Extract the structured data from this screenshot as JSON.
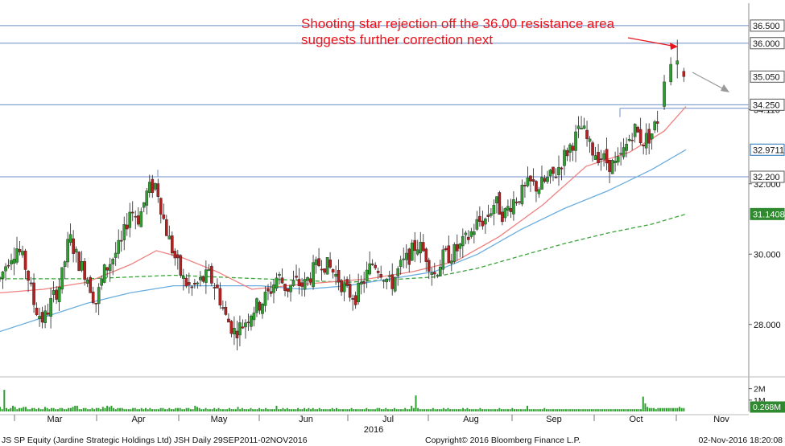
{
  "chart_data": {
    "type": "candlestick",
    "annotation": {
      "line1": "Shooting star rejection off the 36.00 resistance area",
      "line2": "suggests further correction next",
      "color": "#e8141c"
    },
    "price_axis": {
      "range": [
        26.6,
        37.0
      ],
      "ticks": [
        {
          "value": 28,
          "label": "28.000"
        },
        {
          "value": 30,
          "label": "30.000"
        },
        {
          "value": 32,
          "label": "32.000"
        },
        {
          "value": 34.11,
          "label": "34.110"
        }
      ]
    },
    "level_tags": [
      {
        "value": 36.5,
        "label": "36.500",
        "style": "line"
      },
      {
        "value": 36.0,
        "label": "36.000",
        "style": "line"
      },
      {
        "value": 35.05,
        "label": "35.050",
        "style": "price"
      },
      {
        "value": 34.25,
        "label": "34.250",
        "style": "line"
      },
      {
        "value": 32.9711,
        "label": "32.9711",
        "style": "blue"
      },
      {
        "value": 32.2,
        "label": "32.200",
        "style": "line"
      },
      {
        "value": 31.1408,
        "label": "31.1408",
        "style": "green"
      }
    ],
    "volume_axis": {
      "ticks": [
        {
          "value": 2,
          "label": "2M"
        },
        {
          "value": 1,
          "label": "1M"
        }
      ],
      "current_label": "0.268M"
    },
    "x_labels": [
      "Mar",
      "Apr",
      "May",
      "Jun",
      "Jul",
      "Aug",
      "Sep",
      "Oct",
      "Nov"
    ],
    "year_label": "2016",
    "resistance_lines": [
      {
        "value": 36.5,
        "from": "left"
      },
      {
        "value": 36.0,
        "from": "left"
      },
      {
        "value": 34.25,
        "from": "left"
      },
      {
        "value": 32.2,
        "from": "left"
      }
    ],
    "price_path": [
      [
        0,
        29.3
      ],
      [
        4,
        29.9
      ],
      [
        8,
        30.2
      ],
      [
        12,
        29.6
      ],
      [
        16,
        28.5
      ],
      [
        20,
        28.1
      ],
      [
        24,
        28.7
      ],
      [
        28,
        29.2
      ],
      [
        32,
        30.5
      ],
      [
        36,
        29.8
      ],
      [
        40,
        29.4
      ],
      [
        44,
        28.6
      ],
      [
        48,
        29.5
      ],
      [
        52,
        29.9
      ],
      [
        56,
        30.3
      ],
      [
        60,
        31.3
      ],
      [
        64,
        31.0
      ],
      [
        68,
        31.8
      ],
      [
        72,
        32.0
      ],
      [
        76,
        30.8
      ],
      [
        80,
        30.0
      ],
      [
        84,
        29.3
      ],
      [
        88,
        29.0
      ],
      [
        92,
        29.2
      ],
      [
        96,
        29.4
      ],
      [
        100,
        29.0
      ],
      [
        104,
        28.2
      ],
      [
        108,
        27.8
      ],
      [
        112,
        28.0
      ],
      [
        116,
        28.4
      ],
      [
        120,
        28.6
      ],
      [
        124,
        28.9
      ],
      [
        128,
        29.4
      ],
      [
        132,
        29.0
      ],
      [
        136,
        29.2
      ],
      [
        140,
        29.1
      ],
      [
        144,
        29.5
      ],
      [
        148,
        29.8
      ],
      [
        152,
        29.6
      ],
      [
        156,
        29.3
      ],
      [
        160,
        28.9
      ],
      [
        164,
        28.8
      ],
      [
        168,
        29.3
      ],
      [
        172,
        29.8
      ],
      [
        176,
        29.5
      ],
      [
        180,
        29.1
      ],
      [
        184,
        29.6
      ],
      [
        188,
        29.9
      ],
      [
        192,
        30.3
      ],
      [
        196,
        30.0
      ],
      [
        200,
        29.4
      ],
      [
        204,
        29.9
      ],
      [
        208,
        30.0
      ],
      [
        212,
        30.2
      ],
      [
        216,
        30.5
      ],
      [
        220,
        30.9
      ],
      [
        224,
        31.0
      ],
      [
        228,
        31.5
      ],
      [
        232,
        31.1
      ],
      [
        236,
        31.5
      ],
      [
        240,
        31.7
      ],
      [
        244,
        32.0
      ],
      [
        248,
        31.9
      ],
      [
        252,
        32.1
      ],
      [
        256,
        32.3
      ],
      [
        260,
        32.8
      ],
      [
        264,
        33.2
      ],
      [
        268,
        33.6
      ],
      [
        272,
        33.0
      ],
      [
        276,
        32.8
      ],
      [
        280,
        32.6
      ],
      [
        284,
        32.5
      ],
      [
        288,
        33.0
      ],
      [
        292,
        33.6
      ],
      [
        296,
        33.2
      ],
      [
        300,
        33.4
      ],
      [
        304,
        34.0
      ],
      [
        308,
        34.3
      ],
      [
        312,
        35.0
      ],
      [
        316,
        34.9
      ]
    ],
    "ma_fast": [
      [
        0,
        28.9
      ],
      [
        20,
        29.0
      ],
      [
        40,
        29.2
      ],
      [
        60,
        29.7
      ],
      [
        72,
        30.1
      ],
      [
        84,
        29.9
      ],
      [
        100,
        29.5
      ],
      [
        116,
        29.0
      ],
      [
        132,
        29.1
      ],
      [
        150,
        29.2
      ],
      [
        170,
        29.3
      ],
      [
        190,
        29.5
      ],
      [
        210,
        29.8
      ],
      [
        230,
        30.5
      ],
      [
        250,
        31.4
      ],
      [
        270,
        32.5
      ],
      [
        290,
        32.9
      ],
      [
        306,
        33.5
      ],
      [
        316,
        34.2
      ]
    ],
    "ma_mid": [
      [
        0,
        27.8
      ],
      [
        20,
        28.2
      ],
      [
        40,
        28.6
      ],
      [
        60,
        28.9
      ],
      [
        80,
        29.1
      ],
      [
        100,
        29.1
      ],
      [
        120,
        29.1
      ],
      [
        140,
        29.0
      ],
      [
        160,
        29.1
      ],
      [
        180,
        29.3
      ],
      [
        200,
        29.5
      ],
      [
        220,
        30.0
      ],
      [
        240,
        30.7
      ],
      [
        260,
        31.3
      ],
      [
        280,
        31.8
      ],
      [
        300,
        32.4
      ],
      [
        316,
        32.97
      ]
    ],
    "ma_slow": [
      [
        0,
        29.3
      ],
      [
        40,
        29.3
      ],
      [
        80,
        29.4
      ],
      [
        120,
        29.3
      ],
      [
        160,
        29.2
      ],
      [
        200,
        29.35
      ],
      [
        220,
        29.6
      ],
      [
        240,
        29.95
      ],
      [
        260,
        30.3
      ],
      [
        280,
        30.6
      ],
      [
        300,
        30.85
      ],
      [
        316,
        31.14
      ]
    ],
    "volume_bars": [
      0.4,
      0.2,
      1.9,
      0.3,
      0.2,
      0.3,
      0.5,
      0.4,
      0.2,
      0.3,
      0.3,
      0.4,
      0.4,
      0.2,
      0.2,
      0.3,
      0.3,
      0.2,
      0.3,
      0.2,
      0.2,
      0.4,
      0.3,
      0.2,
      0.3,
      0.3,
      0.2,
      0.2,
      0.3,
      0.3,
      0.2,
      0.2,
      0.3,
      0.3,
      0.4,
      0.5,
      0.5,
      0.2,
      0.2,
      0.3,
      0.3,
      0.2,
      0.2,
      0.3,
      0.2,
      0.3,
      0.3,
      0.2,
      0.4,
      0.3,
      0.5,
      0.4,
      0.5,
      0.3,
      0.2,
      0.3,
      0.3,
      0.3,
      0.2,
      0.2,
      0.2,
      0.2,
      0.3,
      0.3,
      0.2,
      0.2,
      0.3,
      0.2,
      0.3,
      0.2,
      0.3,
      0.2,
      0.2,
      0.2,
      0.2,
      0.3,
      0.3,
      0.2,
      0.2,
      0.3,
      0.2,
      0.2,
      0.3,
      0.3,
      0.3,
      0.2,
      0.2,
      0.3,
      0.3,
      0.2,
      0.2,
      0.5,
      0.4,
      0.3,
      0.2,
      0.2,
      0.3,
      0.2,
      0.2,
      0.2,
      0.3,
      0.2,
      0.3,
      0.2,
      0.2,
      0.2,
      0.2,
      0.3,
      0.2,
      0.2,
      0.2,
      0.4,
      0.2,
      0.3,
      0.2,
      0.2,
      0.2,
      0.3,
      0.2,
      0.2,
      0.2,
      0.3,
      0.2,
      0.2,
      0.3,
      0.2,
      0.2,
      0.2,
      0.2,
      0.5,
      0.2,
      0.2,
      0.3,
      0.2,
      0.3,
      0.2,
      0.2,
      0.2,
      0.2,
      0.3,
      0.2,
      0.2,
      0.3,
      0.2,
      0.3,
      0.2,
      0.3,
      0.2,
      0.2,
      0.3,
      0.2,
      0.2,
      0.2,
      0.2,
      0.2,
      0.3,
      0.2,
      0.3,
      0.2,
      0.2,
      0.2,
      0.2,
      0.2,
      0.2,
      0.3,
      0.2,
      0.2,
      0.2,
      0.2,
      0.2,
      0.2,
      0.3,
      0.2,
      0.2,
      0.2,
      0.2,
      0.3,
      0.3,
      0.2,
      0.2,
      0.3,
      0.2,
      0.2,
      0.2,
      0.3,
      0.2,
      0.2,
      0.2,
      0.2,
      0.3,
      0.2,
      0.2,
      0.5,
      0.3,
      1.4,
      0.3,
      0.2,
      0.2,
      0.2,
      0.2,
      0.2,
      0.2,
      0.3,
      0.2,
      0.2,
      0.2,
      0.2,
      0.3,
      0.2,
      0.3,
      0.2,
      0.2,
      0.2,
      0.2,
      0.2,
      0.2,
      0.3,
      0.2,
      0.3,
      0.2,
      0.2,
      0.2,
      0.2,
      0.2,
      0.3,
      0.2,
      0.2,
      0.2,
      0.2,
      0.2,
      0.2,
      0.2,
      0.2,
      0.3,
      0.2,
      0.2,
      0.2,
      0.2,
      0.2,
      0.3,
      0.2,
      0.2,
      0.2,
      0.2,
      0.2,
      0.2,
      0.5,
      0.2,
      0.2,
      0.2,
      0.2,
      0.2,
      0.2,
      0.2,
      0.3,
      0.2,
      0.2,
      0.2,
      0.2,
      0.2,
      0.2,
      0.2,
      0.2,
      0.2,
      0.2,
      0.2,
      0.2,
      0.2,
      0.2,
      0.2,
      0.2,
      0.2,
      0.2,
      0.2,
      0.2,
      0.2,
      0.2,
      0.2,
      0.2,
      0.2,
      0.2,
      0.2,
      0.2,
      0.2,
      0.2,
      0.2,
      0.2,
      0.2,
      0.2,
      0.2,
      0.2,
      0.2,
      0.2,
      0.2,
      0.2,
      0.2,
      0.2,
      0.2,
      0.2,
      0.2,
      1.3,
      0.7,
      0.4,
      0.3,
      0.3,
      0.3,
      0.2,
      0.3,
      0.3,
      0.3,
      0.3,
      0.3,
      0.3,
      0.3,
      0.3,
      0.3,
      0.3,
      0.4,
      0.3,
      0.3
    ]
  },
  "footer": {
    "left": "JS SP Equity (Jardine Strategic Holdings Ltd) JSH  Daily 29SEP2011-02NOV2016",
    "center": "Copyright© 2016 Bloomberg Finance L.P.",
    "right": "02-Nov-2016 18:20:08"
  },
  "colors": {
    "up": "#2e9e2e",
    "down": "#b52020",
    "ma_fast": "#f08080",
    "ma_mid": "#6aaee0",
    "ma_slow": "#3aa33a",
    "hline": "#6c8ec8",
    "tag_green": "#2f8a2f",
    "tag_blue": "#2272b8"
  }
}
